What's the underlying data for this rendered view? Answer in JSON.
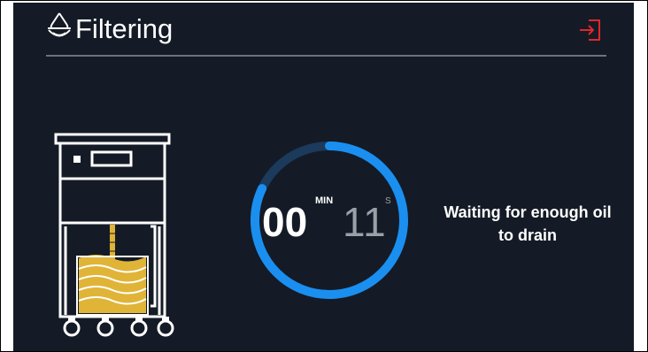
{
  "header": {
    "title": "Filtering",
    "icon": "oil-drop-filter-icon",
    "exit_icon": "exit-door-icon"
  },
  "timer": {
    "minutes": "00",
    "minutes_label": "MIN",
    "seconds": "11",
    "seconds_label": "S",
    "progress_fraction": 0.82
  },
  "status": {
    "message_line1": "Waiting for enough oil",
    "message_line2": "to drain"
  },
  "colors": {
    "background": "#141b26",
    "ring_active": "#1a8ff0",
    "ring_track": "#1b3a5c",
    "exit_icon": "#e0262c",
    "oil": "#e0b437"
  }
}
